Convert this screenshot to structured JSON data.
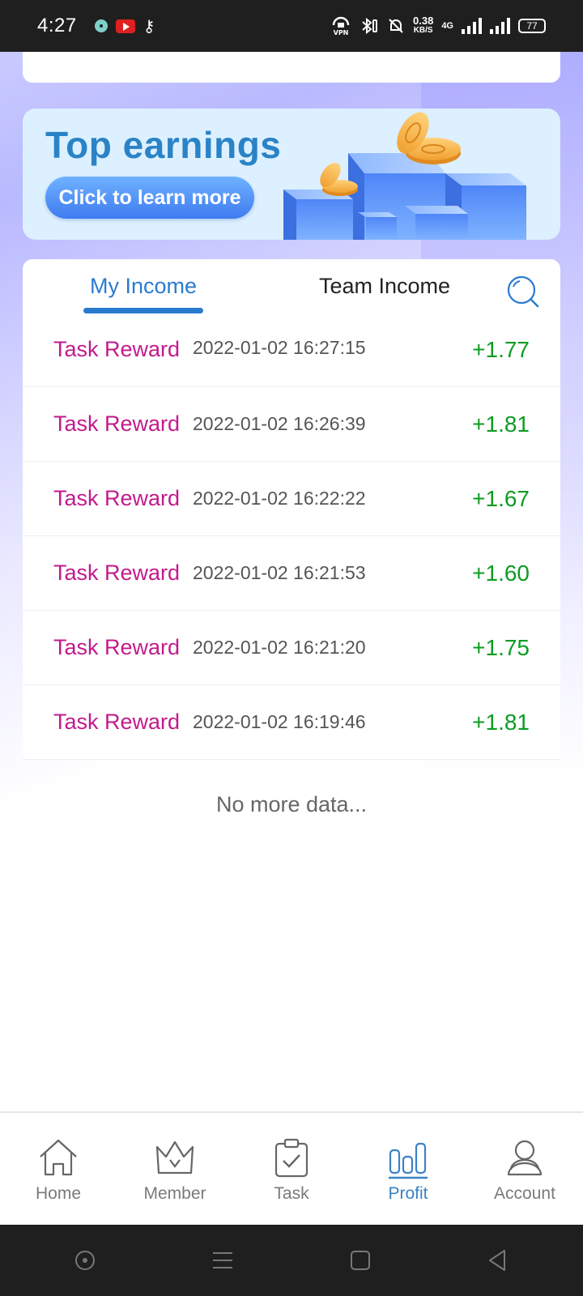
{
  "status_bar": {
    "time": "4:27",
    "speed_value": "0.38",
    "speed_unit": "KB/S",
    "network": "4G",
    "battery": "77",
    "vpn_label": "VPN"
  },
  "banner": {
    "title": "Top earnings",
    "button_label": "Click to learn more"
  },
  "tabs": [
    {
      "label": "My Income",
      "active": true
    },
    {
      "label": "Team Income",
      "active": false
    }
  ],
  "records": [
    {
      "label": "Task Reward",
      "time": "2022-01-02 16:27:15",
      "amount": "+1.77"
    },
    {
      "label": "Task Reward",
      "time": "2022-01-02 16:26:39",
      "amount": "+1.81"
    },
    {
      "label": "Task Reward",
      "time": "2022-01-02 16:22:22",
      "amount": "+1.67"
    },
    {
      "label": "Task Reward",
      "time": "2022-01-02 16:21:53",
      "amount": "+1.60"
    },
    {
      "label": "Task Reward",
      "time": "2022-01-02 16:21:20",
      "amount": "+1.75"
    },
    {
      "label": "Task Reward",
      "time": "2022-01-02 16:19:46",
      "amount": "+1.81"
    }
  ],
  "no_more_text": "No more data...",
  "bottom_nav": [
    {
      "label": "Home",
      "icon": "home-icon"
    },
    {
      "label": "Member",
      "icon": "crown-icon"
    },
    {
      "label": "Task",
      "icon": "clipboard-check-icon"
    },
    {
      "label": "Profit",
      "icon": "bar-chart-icon",
      "active": true
    },
    {
      "label": "Account",
      "icon": "user-icon"
    }
  ],
  "colors": {
    "accent": "#2a7bd0",
    "reward_label": "#c21a8c",
    "amount": "#0c9c22",
    "banner_bg": "#dcf0ff"
  }
}
